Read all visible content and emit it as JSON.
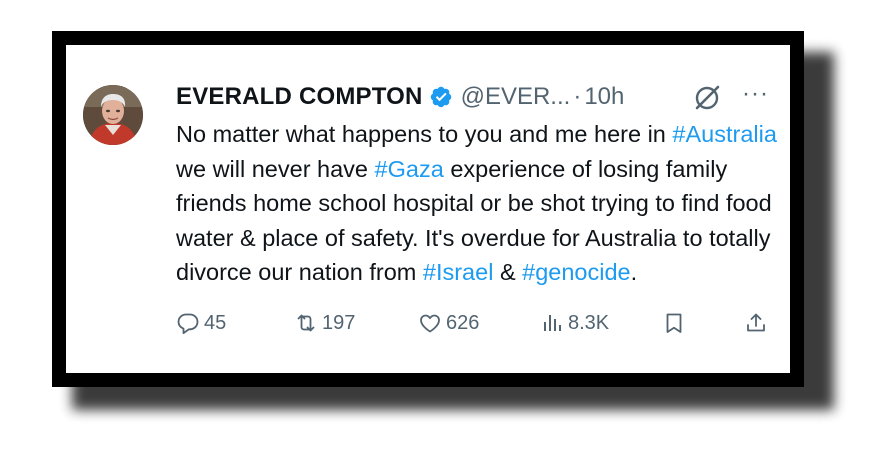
{
  "tweet": {
    "author_name": "EVERALD COMPTON",
    "handle": "@EVER...",
    "separator": "·",
    "time": "10h",
    "more_label": "···",
    "body": {
      "t1": "No matter what happens to you and me here in ",
      "h1": "#Australia",
      "t2": " we will never have ",
      "h2": "#Gaza",
      "t3": " experience of losing family friends home school hospital or be shot trying to find food water & place of safety. It's overdue for Australia to totally divorce our nation from ",
      "h3": "#Israel",
      "t4": " & ",
      "h4": "#genocide",
      "t5": "."
    }
  },
  "actions": {
    "replies": "45",
    "reposts": "197",
    "likes": "626",
    "views": "8.3K"
  },
  "colors": {
    "hashtag": "#1d9bf0",
    "verified": "#1d9bf0",
    "muted": "#536471",
    "text": "#0f1419"
  },
  "icons": {
    "reply": "reply-icon",
    "repost": "repost-icon",
    "like": "heart-icon",
    "views": "views-icon",
    "bookmark": "bookmark-icon",
    "share": "share-icon",
    "verified": "verified-badge-icon",
    "grok": "grok-icon"
  }
}
